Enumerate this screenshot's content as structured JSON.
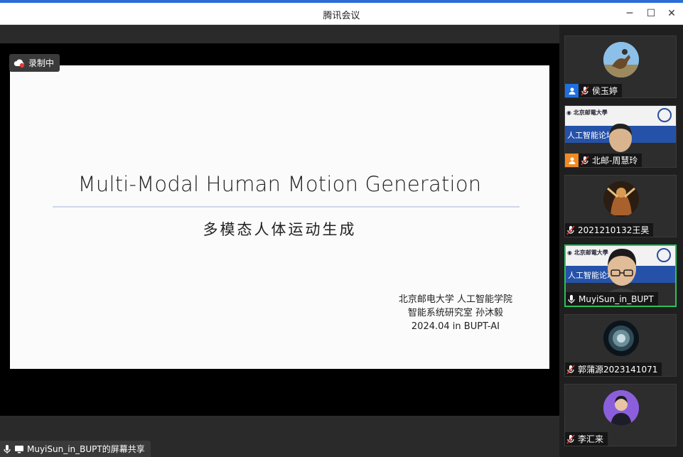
{
  "window": {
    "title": "腾讯会议"
  },
  "recording": {
    "label": "录制中"
  },
  "slide": {
    "title": "Multi-Modal Human Motion Generation",
    "subtitle": "多模态人体运动生成",
    "meta": [
      "北京邮电大学 人工智能学院",
      "智能系统研究室 孙沐毅",
      "2024.04 in BUPT-AI"
    ]
  },
  "share": {
    "label": "MuyiSun_in_BUPT的屏幕共享"
  },
  "participants": [
    {
      "name": "侯玉婷",
      "badge": "host",
      "muted": true
    },
    {
      "name": "北邮-周慧玲",
      "badge": "cohost",
      "muted": true,
      "banner_text": "人工智能论坛"
    },
    {
      "name": "2021210132王昊",
      "muted": true
    },
    {
      "name": "MuyiSun_in_BUPT",
      "muted": false,
      "speaking": true,
      "banner_text": "人工智能论坛"
    },
    {
      "name": "郭蒲源2023141071",
      "muted": true
    },
    {
      "name": "李汇来",
      "muted": true
    }
  ],
  "colors": {
    "accent": "#2b6cd6",
    "speaking_border": "#27c15b",
    "host_badge": "#1e6fe0",
    "cohost_badge": "#f08a24"
  }
}
